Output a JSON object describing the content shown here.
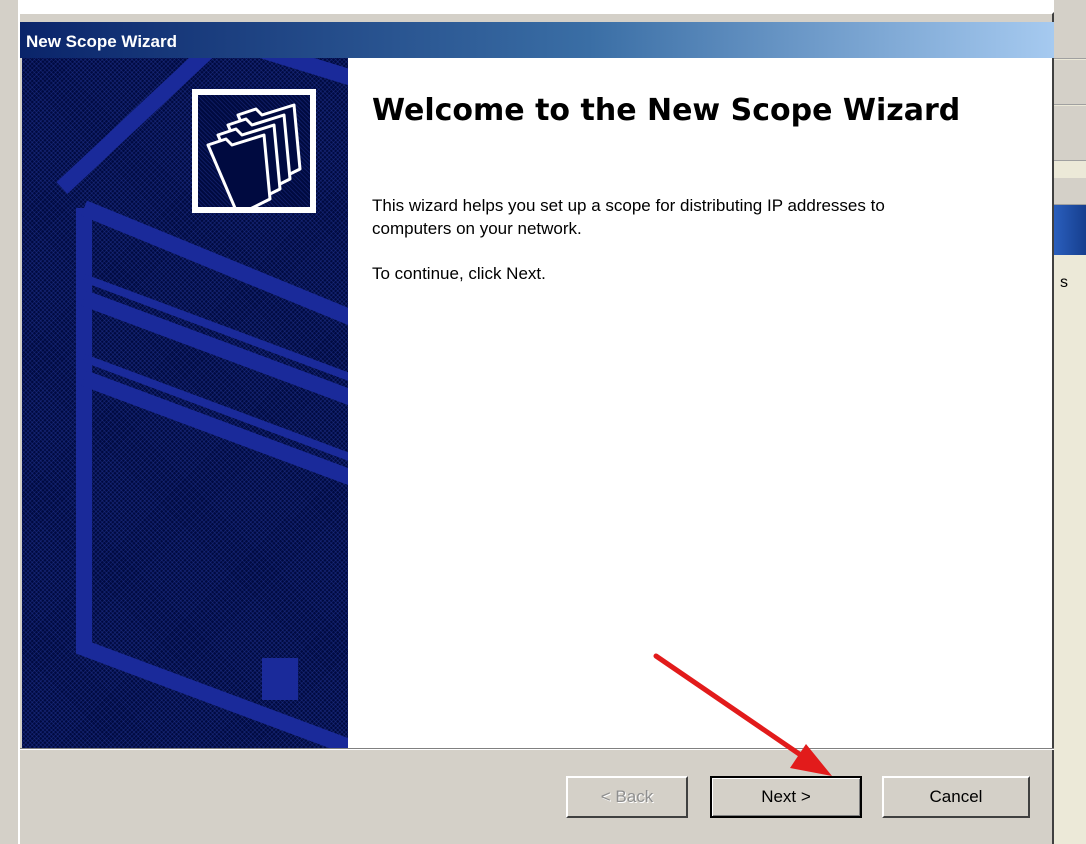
{
  "dialog": {
    "title": "New Scope Wizard",
    "heading": "Welcome to the New Scope Wizard",
    "description": "This wizard helps you set up a scope for distributing IP addresses to computers on your network.",
    "instruction": "To continue, click Next.",
    "icon": "folders-icon"
  },
  "buttons": {
    "back_label": "< Back",
    "next_label": "Next >",
    "cancel_label": "Cancel",
    "back_enabled": false
  },
  "background_window": {
    "partial_text": "s"
  },
  "annotation": {
    "type": "arrow",
    "color": "#e21b1b",
    "points_to": "next-button"
  },
  "colors": {
    "banner": "#000a40",
    "banner_pattern": "#1a2a9a",
    "title_gradient_start": "#0a246a",
    "title_gradient_end": "#a6caf0",
    "dialog_face": "#d4d0c8"
  }
}
